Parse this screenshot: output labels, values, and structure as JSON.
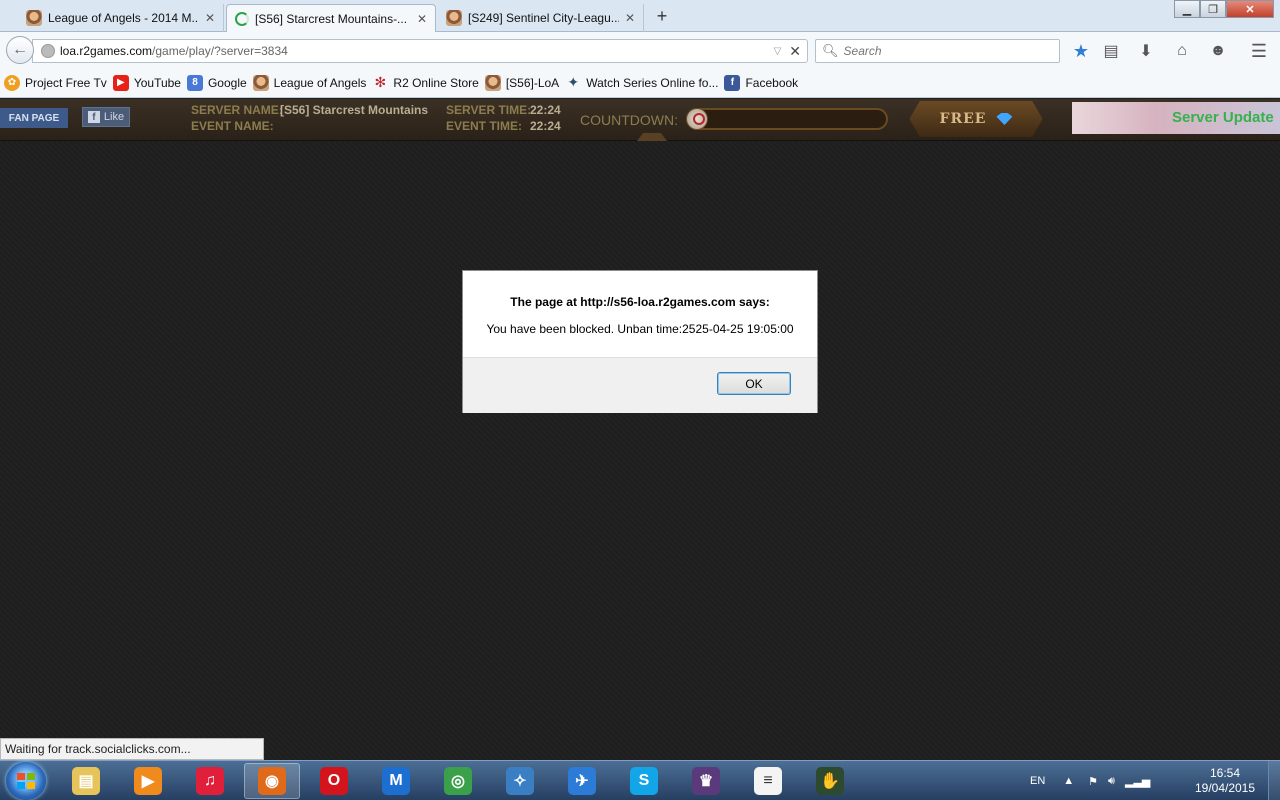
{
  "browser": {
    "tabs": [
      {
        "title": "League of Angels - 2014 M...",
        "active": false,
        "icon": "loa-favicon"
      },
      {
        "title": "[S56] Starcrest Mountains-...",
        "active": true,
        "icon": "loading-spinner"
      },
      {
        "title": "[S249] Sentinel City-Leagu...",
        "active": false,
        "icon": "loa-favicon"
      }
    ],
    "url_host": "loa.r2games.com",
    "url_path": "/game/play/?server=3834",
    "search_placeholder": "Search",
    "bookmarks": [
      {
        "label": "Project Free Tv",
        "icon": "pftv-icon",
        "color": "#f0a020"
      },
      {
        "label": "YouTube",
        "icon": "youtube-icon",
        "color": "#e62117"
      },
      {
        "label": "Google",
        "icon": "google-icon",
        "color": "#4a78d6"
      },
      {
        "label": "League of Angels",
        "icon": "loa-icon",
        "color": "#b98a5a"
      },
      {
        "label": "R2 Online Store",
        "icon": "r2-icon",
        "color": "#c0282f"
      },
      {
        "label": "[S56]-LoA",
        "icon": "loa-icon",
        "color": "#b98a5a"
      },
      {
        "label": "Watch Series Online fo...",
        "icon": "watchseries-icon",
        "color": "#2d4e6b"
      },
      {
        "label": "Facebook",
        "icon": "facebook-icon",
        "color": "#3b5998"
      }
    ]
  },
  "game": {
    "fan_page": "FAN PAGE",
    "like": "Like",
    "server_name_label": "SERVER NAME:",
    "server_name": "[S56] Starcrest Mountains",
    "event_name_label": "EVENT NAME:",
    "event_name": "",
    "server_time_label": "SERVER TIME:",
    "server_time": "22:24",
    "event_time_label": "EVENT TIME:",
    "event_time": "22:24",
    "countdown_label": "COUNTDOWN:",
    "free_label": "FREE",
    "promo_text": "Server Update"
  },
  "dialog": {
    "heading": "The page at http://s56-loa.r2games.com says:",
    "message": "You have been blocked. Unban time:2525-04-25 19:05:00",
    "ok": "OK"
  },
  "status_text": "Waiting for track.socialclicks.com...",
  "taskbar": {
    "apps": [
      {
        "name": "explorer",
        "color": "#e7c45a",
        "glyph": "▤"
      },
      {
        "name": "media-player",
        "color": "#f08a1c",
        "glyph": "▶"
      },
      {
        "name": "itunes",
        "color": "#e0203a",
        "glyph": "♫"
      },
      {
        "name": "firefox",
        "color": "#e06a1a",
        "glyph": "◉",
        "active": true
      },
      {
        "name": "opera",
        "color": "#d4141c",
        "glyph": "O"
      },
      {
        "name": "maxthon",
        "color": "#1c6fd1",
        "glyph": "M"
      },
      {
        "name": "chrome",
        "color": "#3aa14a",
        "glyph": "◎"
      },
      {
        "name": "safari",
        "color": "#3a7fc4",
        "glyph": "✧"
      },
      {
        "name": "thunderbird",
        "color": "#2c7bd6",
        "glyph": "✈"
      },
      {
        "name": "skype",
        "color": "#12a5e8",
        "glyph": "S"
      },
      {
        "name": "game-client",
        "color": "#5a3a7a",
        "glyph": "♛"
      },
      {
        "name": "notepad",
        "color": "#f4f4f4",
        "glyph": "≡"
      },
      {
        "name": "second-life",
        "color": "#2e4a2e",
        "glyph": "✋"
      }
    ],
    "language": "EN",
    "time": "16:54",
    "date": "19/04/2015"
  }
}
